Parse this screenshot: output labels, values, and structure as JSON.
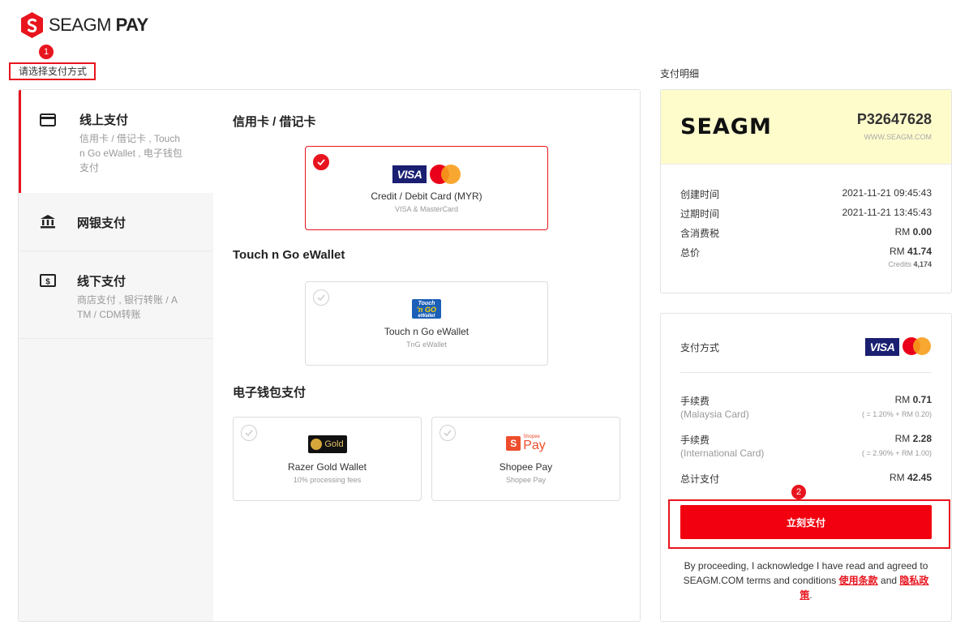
{
  "brand": {
    "logo_text": "SEAGM",
    "logo_pay": "PAY"
  },
  "steps": {
    "step1": "1",
    "step2": "2"
  },
  "section": {
    "choose_method": "请选择支付方式",
    "details": "支付明细"
  },
  "nav": [
    {
      "title": "线上支付",
      "desc": "信用卡 / 借记卡 , Touch n Go eWallet , 电子钱包支付",
      "icon": "credit-card-icon"
    },
    {
      "title": "网银支付",
      "desc": "",
      "icon": "bank-icon"
    },
    {
      "title": "线下支付",
      "desc": "商店支付 , 银行转账 / ATM / CDM转账",
      "icon": "cash-icon"
    }
  ],
  "groups": {
    "cards": "信用卡 / 借记卡",
    "tng": "Touch n Go eWallet",
    "ewallet": "电子钱包支付"
  },
  "methods": {
    "card": {
      "name": "Credit / Debit Card (MYR)",
      "sub": "VISA & MasterCard",
      "visa": "VISA"
    },
    "tng": {
      "name": "Touch n Go eWallet",
      "sub": "TnG eWallet",
      "logo_line1": "Touch",
      "logo_line2": "'n GO",
      "logo_line3": "eWallet"
    },
    "razer": {
      "name": "Razer Gold Wallet",
      "sub": "10% processing fees",
      "logo": "Gold"
    },
    "shopee": {
      "name": "Shopee Pay",
      "sub": "Shopee Pay",
      "logo_s": "S",
      "logo_text": "Pay",
      "logo_small": "Shopee"
    }
  },
  "order": {
    "merchant": "SEAGM",
    "number": "P32647628",
    "site": "WWW.SEAGM.COM",
    "created_label": "创建时间",
    "created": "2021-11-21 09:45:43",
    "expire_label": "过期时间",
    "expire": "2021-11-21 13:45:43",
    "tax_label": "含消费税",
    "tax_prefix": "RM",
    "tax": "0.00",
    "total_label": "总价",
    "total_prefix": "RM",
    "total": "41.74",
    "credits_label": "Credits",
    "credits": "4,174"
  },
  "payment": {
    "method_label": "支付方式",
    "visa": "VISA",
    "fee1_label": "手续费",
    "fee1_sub": "(Malaysia Card)",
    "fee1_prefix": "RM",
    "fee1": "0.71",
    "fee1_calc": "( = 1.20% + RM 0.20)",
    "fee2_label": "手续费",
    "fee2_sub": "(International Card)",
    "fee2_prefix": "RM",
    "fee2": "2.28",
    "fee2_calc": "( = 2.90% + RM 1.00)",
    "grand_label": "总计支付",
    "grand_prefix": "RM",
    "grand": "42.45",
    "pay_button": "立刻支付",
    "terms_text": "By proceeding, I acknowledge I have read and agreed to SEAGM.COM terms and conditions",
    "terms_link": "使用条款",
    "and": "and",
    "privacy_link": "隐私政策",
    "period": "."
  },
  "colors": {
    "accent": "#e8141e",
    "highlight": "#fffccc",
    "visa": "#1a1f71"
  }
}
